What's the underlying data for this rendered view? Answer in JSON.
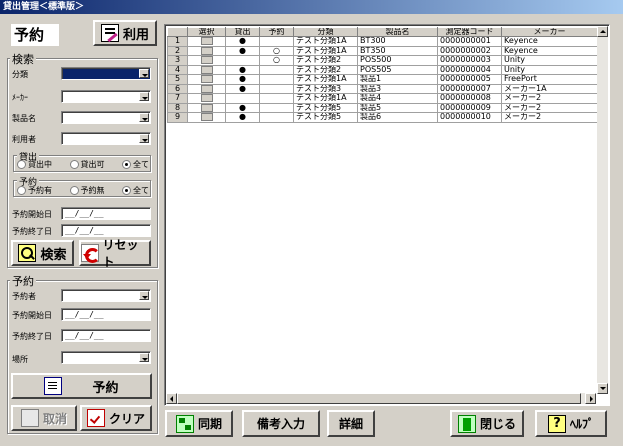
{
  "window": {
    "title": "貸出管理＜標準版＞"
  },
  "header": {
    "mode_title": "予約",
    "use_button": "利用"
  },
  "search": {
    "group_label": "検索",
    "category_label": "分類",
    "maker_label": "ﾒｰｶｰ",
    "product_label": "製品名",
    "user_label": "利用者",
    "lending": {
      "label": "貸出",
      "options": [
        "貸出中",
        "貸出可",
        "全て"
      ],
      "selected": 2
    },
    "reservation": {
      "label": "予約",
      "options": [
        "予約有",
        "予約無",
        "全て"
      ],
      "selected": 2
    },
    "start_label": "予約開始日",
    "end_label": "予約終了日",
    "start_value": "__/__/__",
    "end_value": "__/__/__",
    "search_button": "検索",
    "reset_button": "リセット"
  },
  "reserve": {
    "group_label": "予約",
    "reserver_label": "予約者",
    "start_label": "予約開始日",
    "end_label": "予約終了日",
    "place_label": "場所",
    "start_value": "__/__/__",
    "end_value": "__/__/__",
    "reserve_button": "予約",
    "cancel_button": "取消",
    "clear_button": "クリア"
  },
  "grid": {
    "columns": [
      "選択",
      "貸出",
      "予約",
      "分類",
      "製品名",
      "測定器コード",
      "メーカー"
    ],
    "rows": [
      {
        "num": "1",
        "lent": "●",
        "reserved": "",
        "category": "テスト分類1A",
        "product": "BT300",
        "code": "0000000001",
        "maker": "Keyence"
      },
      {
        "num": "2",
        "lent": "●",
        "reserved": "○",
        "category": "テスト分類1A",
        "product": "BT350",
        "code": "0000000002",
        "maker": "Keyence"
      },
      {
        "num": "3",
        "lent": "",
        "reserved": "○",
        "category": "テスト分類2",
        "product": "POS500",
        "code": "0000000003",
        "maker": "Unity"
      },
      {
        "num": "4",
        "lent": "●",
        "reserved": "",
        "category": "テスト分類2",
        "product": "POS505",
        "code": "0000000004",
        "maker": "Unity"
      },
      {
        "num": "5",
        "lent": "●",
        "reserved": "",
        "category": "テスト分類1A",
        "product": "製品1",
        "code": "0000000005",
        "maker": "FreePort"
      },
      {
        "num": "6",
        "lent": "●",
        "reserved": "",
        "category": "テスト分類3",
        "product": "製品3",
        "code": "0000000007",
        "maker": "メーカー1A"
      },
      {
        "num": "7",
        "lent": "",
        "reserved": "",
        "category": "テスト分類1A",
        "product": "製品4",
        "code": "0000000008",
        "maker": "メーカー2"
      },
      {
        "num": "8",
        "lent": "●",
        "reserved": "",
        "category": "テスト分類5",
        "product": "製品5",
        "code": "0000000009",
        "maker": "メーカー2"
      },
      {
        "num": "9",
        "lent": "●",
        "reserved": "",
        "category": "テスト分類5",
        "product": "製品6",
        "code": "0000000010",
        "maker": "メーカー2"
      }
    ]
  },
  "footer": {
    "sync_button": "同期",
    "note_button": "備考入力",
    "detail_button": "詳細",
    "close_button": "閉じる",
    "help_button": "ﾍﾙﾌﾟ"
  },
  "colors": {
    "titlebar_start": "#0a246a",
    "titlebar_end": "#a6caf0",
    "category_combo": "#0a246a",
    "face": "#d4d0c8"
  }
}
